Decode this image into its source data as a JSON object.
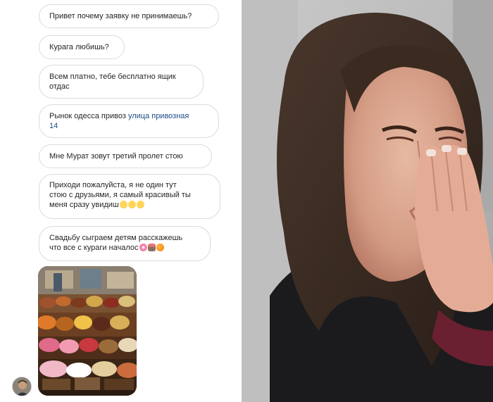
{
  "messages": [
    {
      "text": "Привет почему заявку не принимаешь?"
    },
    {
      "text": "Курага любишь?"
    },
    {
      "line1": "Всем платно, тебе бесплатно ящик",
      "line2": "отдас"
    },
    {
      "prefix": "Рынок одесса привоз ",
      "link1": "улица привозная",
      "link2": "14"
    },
    {
      "text": "Мне Мурат зовут третий пролет стою"
    },
    {
      "line1": "Приходи пожалуйста, я не один тут",
      "line2": "стою с друзьями, я самый красивый ты",
      "line3": "меня сразу увидиш",
      "emojis": [
        "smiling-face",
        "smiling-face",
        "smiling-face"
      ]
    },
    {
      "line1": "Свадьбу сыграем детям расскажешь",
      "line2": "что все с кураги началос",
      "emojis": [
        "cherry-blossom",
        "bouquet",
        "tangerine"
      ]
    }
  ],
  "attachment": {
    "icon": "market-photo"
  },
  "sender": {
    "icon": "avatar"
  },
  "reaction_photo": {
    "icon": "crying-woman-photo"
  },
  "colors": {
    "bubble_border": "#dbdbdb",
    "text": "#262626",
    "link": "#1d4e89"
  }
}
